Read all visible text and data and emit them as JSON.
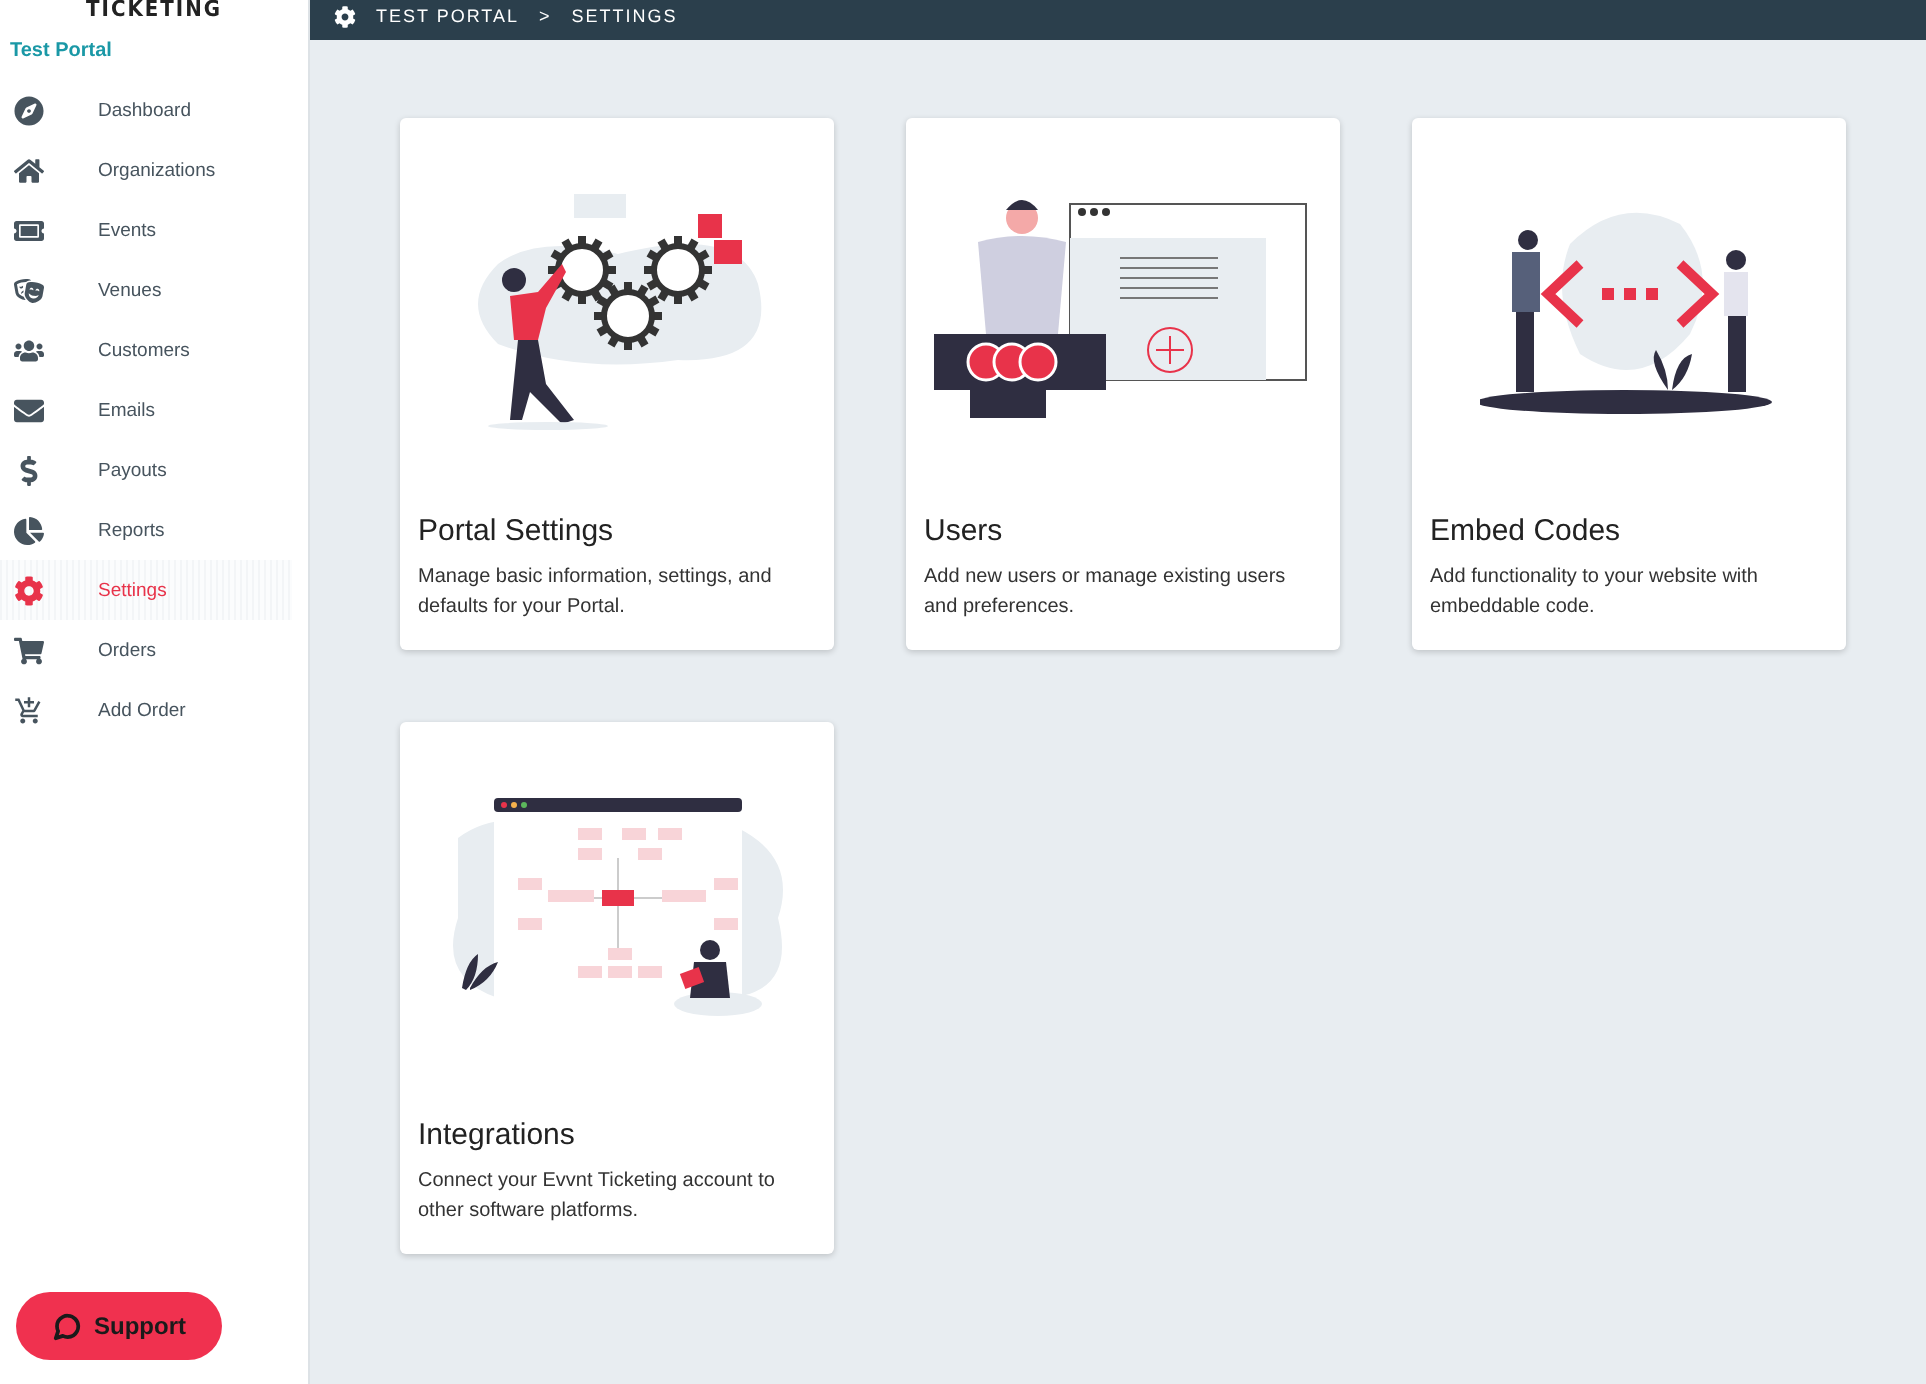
{
  "sidebar": {
    "logo": "TICKETING",
    "portal": "Test Portal",
    "items": [
      {
        "label": "Dashboard",
        "selected": false
      },
      {
        "label": "Organizations",
        "selected": false
      },
      {
        "label": "Events",
        "selected": false
      },
      {
        "label": "Venues",
        "selected": false
      },
      {
        "label": "Customers",
        "selected": false
      },
      {
        "label": "Emails",
        "selected": false
      },
      {
        "label": "Payouts",
        "selected": false
      },
      {
        "label": "Reports",
        "selected": false
      },
      {
        "label": "Settings",
        "selected": true
      },
      {
        "label": "Orders",
        "selected": false
      },
      {
        "label": "Add Order",
        "selected": false
      }
    ],
    "support": "Support"
  },
  "breadcrumb": [
    "TEST PORTAL",
    ">",
    "SETTINGS"
  ],
  "cards": [
    {
      "kind": "gears",
      "title": "Portal Settings",
      "description": "Manage basic information, settings, and defaults for your Portal."
    },
    {
      "kind": "users",
      "title": "Users",
      "description": "Add new users or manage existing users and preferences."
    },
    {
      "kind": "code",
      "title": "Embed Codes",
      "description": "Add functionality to your website with embeddable code."
    },
    {
      "kind": "diagram",
      "title": "Integrations",
      "description": "Connect your Evvnt Ticketing account to other software platforms."
    }
  ]
}
